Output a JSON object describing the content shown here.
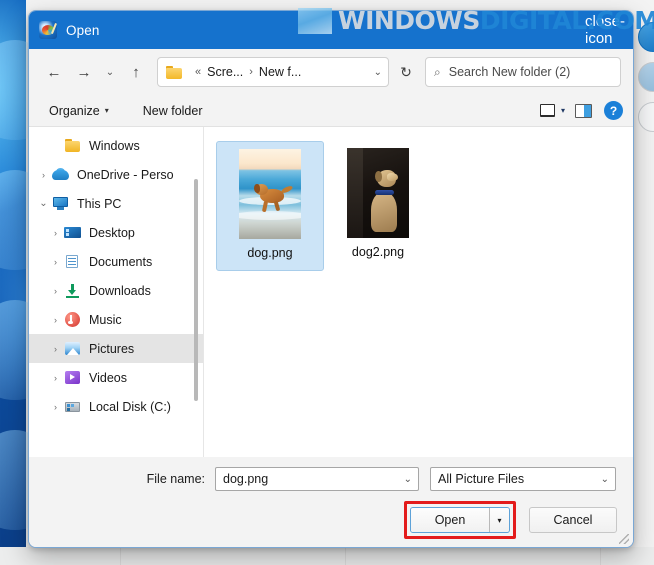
{
  "window": {
    "title": "Open",
    "app_icon": "paint-palette-icon",
    "close_icon": "close-icon"
  },
  "watermark": {
    "part1": "WINDOWS",
    "part2": "DIGITAL.COM",
    "color1": "#d6dbe0",
    "color2": "#1f86d6"
  },
  "nav": {
    "back_icon": "←",
    "forward_icon": "→",
    "recent_icon": "⌄",
    "up_icon": "↑",
    "refresh_icon": "↻",
    "breadcrumb": {
      "folder_icon": "folder-icon",
      "prefix": "«",
      "crumb1": "Scre...",
      "separator": "›",
      "crumb2": "New f...",
      "chevron": "⌄"
    },
    "search": {
      "icon": "⌕",
      "placeholder": "Search New folder (2)"
    }
  },
  "command_bar": {
    "organize_label": "Organize",
    "organize_caret": "▾",
    "new_folder_label": "New folder",
    "view_caret": "▾",
    "view_icon": "layout-view-icon",
    "preview_pane_icon": "preview-pane-icon",
    "help_label": "?"
  },
  "sidebar": {
    "items": [
      {
        "label": "Windows",
        "icon": "folder-icon",
        "expander": "",
        "indent": 1,
        "selected": false
      },
      {
        "label": "OneDrive - Perso",
        "icon": "onedrive-icon",
        "expander": "›",
        "indent": 0,
        "selected": false
      },
      {
        "label": "This PC",
        "icon": "this-pc-icon",
        "expander": "⌄",
        "indent": 0,
        "selected": false
      },
      {
        "label": "Desktop",
        "icon": "desktop-icon",
        "expander": "›",
        "indent": 1,
        "selected": false
      },
      {
        "label": "Documents",
        "icon": "documents-icon",
        "expander": "›",
        "indent": 1,
        "selected": false
      },
      {
        "label": "Downloads",
        "icon": "downloads-icon",
        "expander": "›",
        "indent": 1,
        "selected": false
      },
      {
        "label": "Music",
        "icon": "music-icon",
        "expander": "›",
        "indent": 1,
        "selected": false
      },
      {
        "label": "Pictures",
        "icon": "pictures-icon",
        "expander": "›",
        "indent": 1,
        "selected": true
      },
      {
        "label": "Videos",
        "icon": "videos-icon",
        "expander": "›",
        "indent": 1,
        "selected": false
      },
      {
        "label": "Local Disk (C:)",
        "icon": "local-disk-icon",
        "expander": "›",
        "indent": 1,
        "selected": false
      }
    ]
  },
  "files": [
    {
      "name": "dog.png",
      "selected": true,
      "thumb": "dog-running-on-beach"
    },
    {
      "name": "dog2.png",
      "selected": false,
      "thumb": "dog-sitting-dark-background"
    }
  ],
  "bottom": {
    "filename_label": "File name:",
    "filename_value": "dog.png",
    "filter_value": "All Picture Files",
    "combo_caret": "⌄",
    "open_label": "Open",
    "open_caret": "▾",
    "cancel_label": "Cancel",
    "highlight_color": "#e31b1b"
  }
}
